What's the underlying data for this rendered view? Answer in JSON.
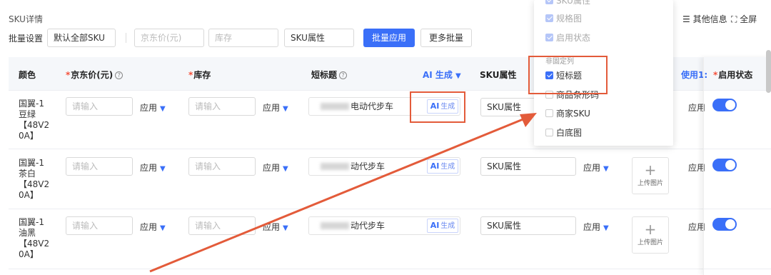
{
  "section_title": "SKU详情",
  "batch": {
    "label": "批量设置",
    "scope_select": "默认全部SKU",
    "price_placeholder": "京东价(元)",
    "stock_placeholder": "库存",
    "attr_select": "SKU属性",
    "apply_button": "批量应用",
    "more_button": "更多批量"
  },
  "top_right": {
    "other_info": "其他信息",
    "fullscreen": "全屏"
  },
  "columns": {
    "color": "颜色",
    "price": "京东价(元)",
    "stock": "库存",
    "short_title": "短标题",
    "ai_generate": "AI 生成",
    "sku_attr": "SKU属性",
    "use_partial": "使用1:",
    "enable_status": "启用状态"
  },
  "rows": [
    {
      "color_lines": [
        "国翼-1",
        "豆绿",
        "【48V2",
        "0A】"
      ],
      "price_placeholder": "请输入",
      "stock_placeholder": "请输入",
      "apply": "应用",
      "short_title": "电动代步车",
      "ai_tag": "生成",
      "sku_attr": "SKU属性",
      "enabled": true
    },
    {
      "color_lines": [
        "国翼-1",
        "茶白",
        "【48V2",
        "0A】"
      ],
      "price_placeholder": "请输入",
      "stock_placeholder": "请输入",
      "apply": "应用",
      "short_title": "动代步车",
      "ai_tag": "生成",
      "sku_attr": "SKU属性",
      "upload": "上传图片",
      "enabled": true
    },
    {
      "color_lines": [
        "国翼-1",
        "油黑",
        "【48V2",
        "0A】"
      ],
      "price_placeholder": "请输入",
      "stock_placeholder": "请输入",
      "apply": "应用",
      "short_title": "动代步车",
      "ai_tag": "生成",
      "sku_attr": "SKU属性",
      "upload": "上传图片",
      "enabled": true
    }
  ],
  "dropdown": {
    "fixed_items": [
      "SKU属性",
      "规格图",
      "启用状态"
    ],
    "section_label": "非固定列",
    "optional_items": [
      {
        "label": "短标题",
        "checked": true
      },
      {
        "label": "商品条形码",
        "checked": false
      },
      {
        "label": "商家SKU",
        "checked": false
      },
      {
        "label": "白底图",
        "checked": false
      }
    ]
  },
  "colors": {
    "accent": "#3a6ff8",
    "annotation": "#e35b3a",
    "required": "#f5503a"
  }
}
